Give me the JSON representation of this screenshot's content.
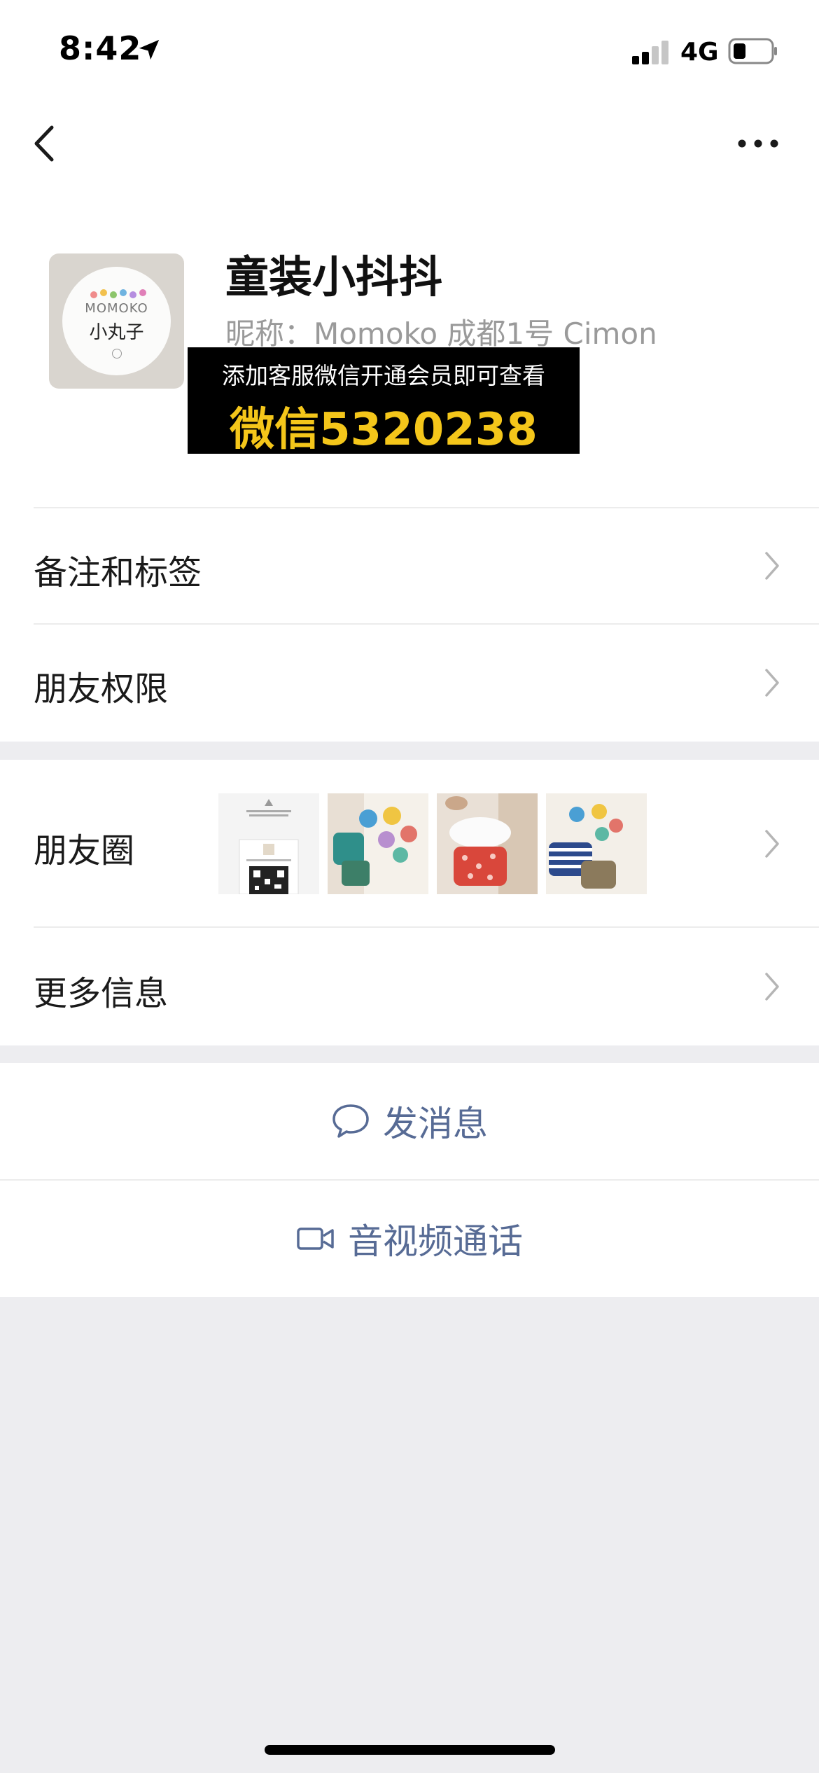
{
  "status_bar": {
    "time": "8:42",
    "network": "4G"
  },
  "nav": {
    "back_icon": "chevron-left-icon",
    "more_icon": "ellipsis-icon"
  },
  "profile": {
    "display_name": "童装小抖抖",
    "nickname": "昵称：Momoko 成都1号 Cimon",
    "avatar": {
      "brand": "MOMOKO",
      "name": "小丸子"
    }
  },
  "promo_overlay": {
    "line1": "添加客服微信开通会员即可查看",
    "line2": "微信5320238"
  },
  "rows": {
    "remarks": "备注和标签",
    "permissions": "朋友权限",
    "moments": "朋友圈",
    "more_info": "更多信息"
  },
  "actions": {
    "message": "发消息",
    "call": "音视频通话"
  },
  "colors": {
    "link_blue": "#576b95",
    "promo_yellow": "#f4c61a",
    "background": "#ededf0"
  }
}
